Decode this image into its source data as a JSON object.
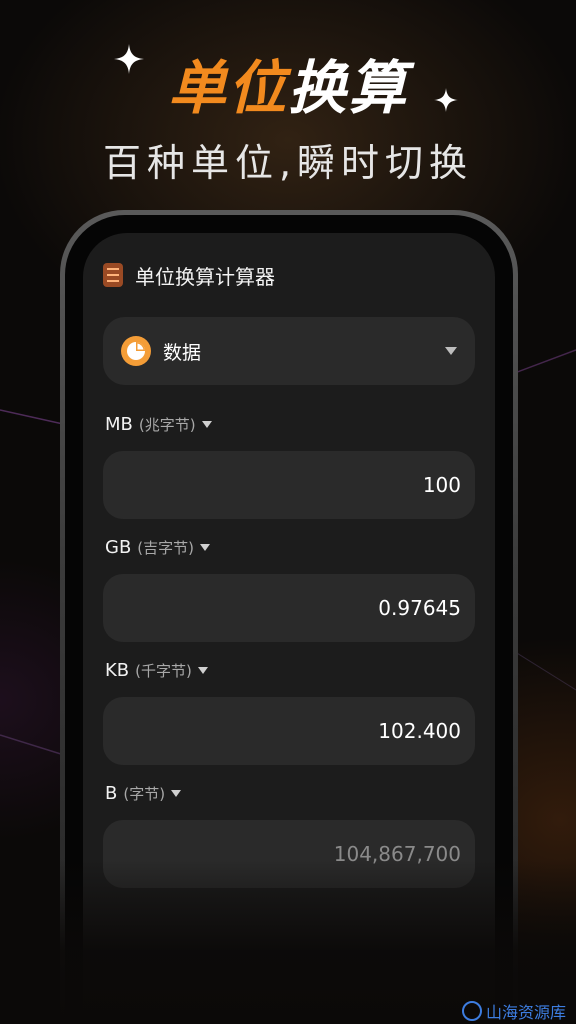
{
  "hero": {
    "title_accent": "单位",
    "title_rest": "换算",
    "subtitle": "百种单位,瞬时切换"
  },
  "app": {
    "title": "单位换算计算器",
    "icon": "list-icon"
  },
  "category": {
    "icon": "pie-chart-icon",
    "label": "数据"
  },
  "units": [
    {
      "code": "MB",
      "name": "(兆字节)",
      "value": "100"
    },
    {
      "code": "GB",
      "name": "(吉字节)",
      "value": "0.97645"
    },
    {
      "code": "KB",
      "name": "(千字节)",
      "value": "102.400"
    },
    {
      "code": "B",
      "name": "(字节)",
      "value": "104,867,700"
    }
  ],
  "watermark": {
    "text": "山海资源库"
  },
  "colors": {
    "accent": "#f28a1e",
    "background": "#0b0908",
    "card": "#2a2a2a",
    "screen": "#1c1c1c",
    "watermark": "#3d7de0"
  }
}
